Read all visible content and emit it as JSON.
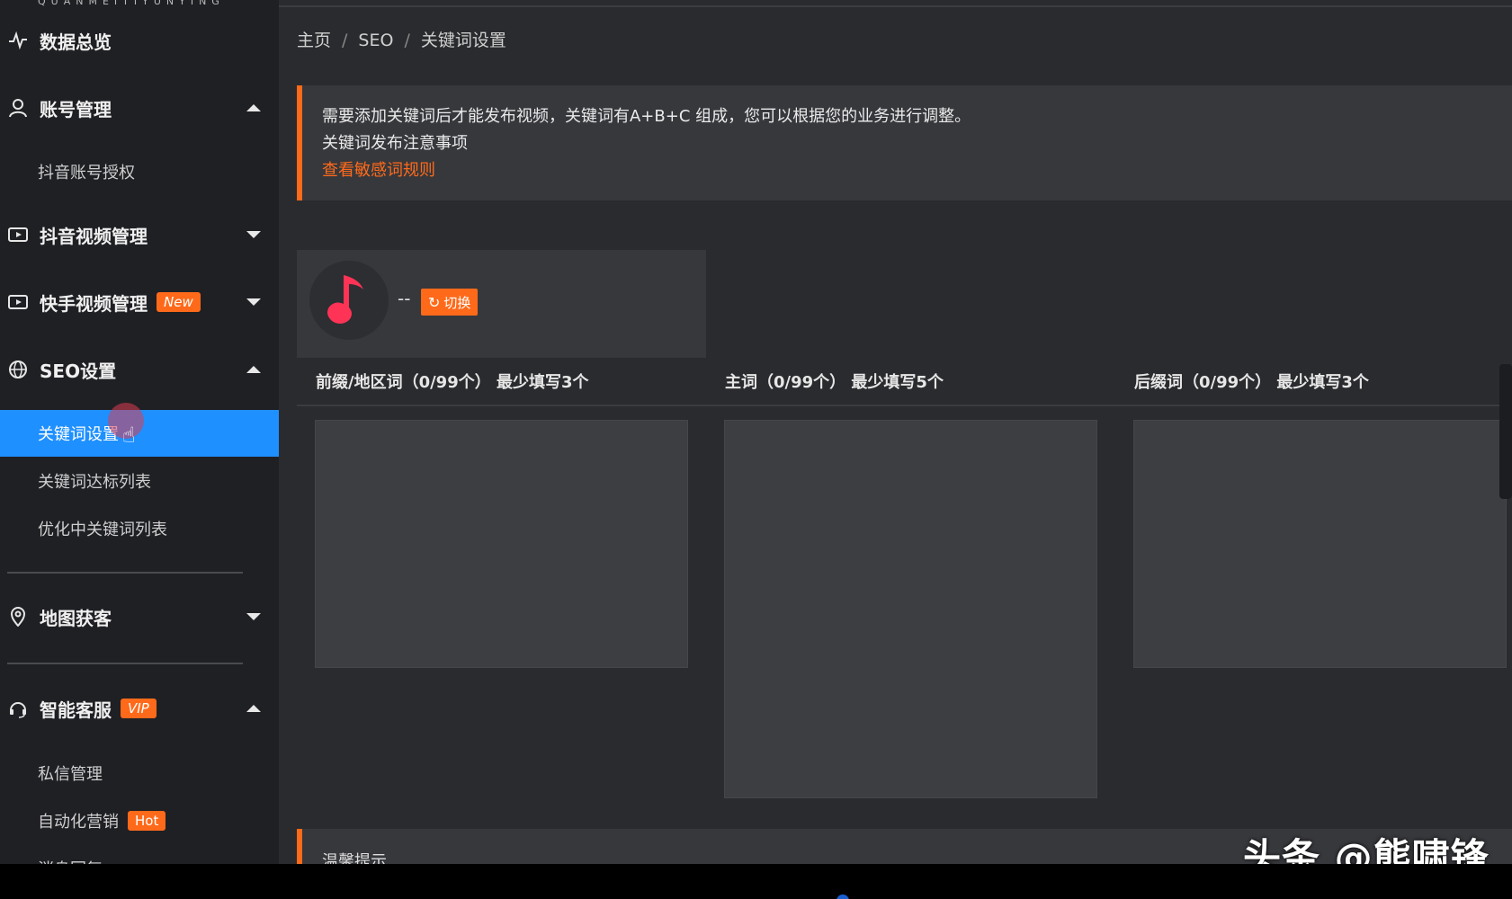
{
  "sidebar": {
    "logo_text": "QUANMEITIYUNYING",
    "overview": "数据总览",
    "account": "账号管理",
    "account_sub": "抖音账号授权",
    "douyin_video": "抖音视频管理",
    "kuaishou_video": "快手视频管理",
    "kuaishou_tag": "New",
    "seo": "SEO设置",
    "seo_sub": [
      "关键词设置",
      "关键词达标列表",
      "优化中关键词列表"
    ],
    "map": "地图获客",
    "smart_cs": "智能客服",
    "smart_cs_tag": "VIP",
    "cs_sub": [
      "私信管理",
      "自动化营销",
      "消息回复"
    ],
    "cs_sub_tag": "Hot"
  },
  "breadcrumb": [
    "主页",
    "SEO",
    "关键词设置"
  ],
  "notice": {
    "line1": "需要添加关键词后才能发布视频，关键词有A+B+C 组成，您可以根据您的业务进行调整。",
    "line2": "关键词发布注意事项",
    "link": "查看敏感词规则"
  },
  "account_card": {
    "name": "--",
    "switch_label": "切换"
  },
  "columns": [
    {
      "title": "前缀/地区词（0/99个） 最少填写3个"
    },
    {
      "title": "主词（0/99个） 最少填写5个"
    },
    {
      "title": "后缀词（0/99个） 最少填写3个"
    }
  ],
  "tips": {
    "title": "温馨提示"
  },
  "watermark": "头条 @熊啸锋",
  "colors": {
    "accent": "#ff6a1a",
    "active": "#1e90ff",
    "sidebar_bg": "#1f2024"
  }
}
